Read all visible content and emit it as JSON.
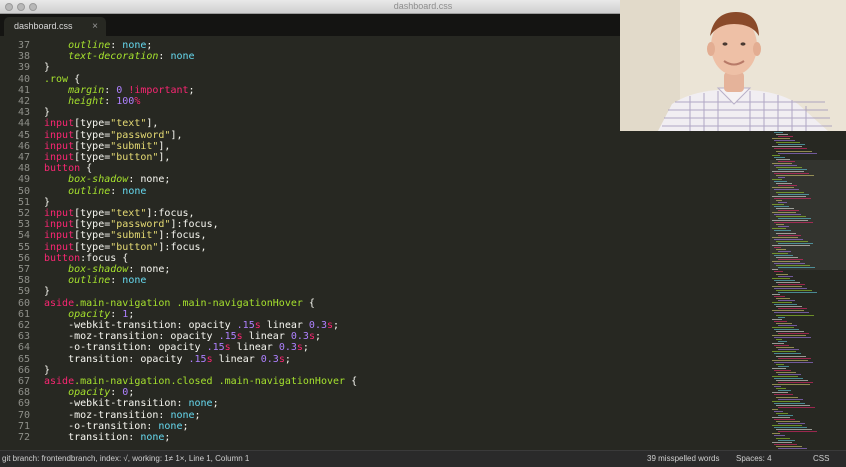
{
  "window": {
    "title": "dashboard.css"
  },
  "tab": {
    "label": "dashboard.css",
    "close": "×"
  },
  "editor": {
    "lines": [
      {
        "n": "37",
        "tokens": [
          [
            "    ",
            "txt"
          ],
          [
            "outline",
            "prop"
          ],
          [
            ": ",
            "txt"
          ],
          [
            "none",
            "val"
          ],
          [
            ";",
            "txt"
          ]
        ]
      },
      {
        "n": "38",
        "tokens": [
          [
            "    ",
            "txt"
          ],
          [
            "text-decoration",
            "prop"
          ],
          [
            ": ",
            "txt"
          ],
          [
            "none",
            "val"
          ]
        ]
      },
      {
        "n": "39",
        "tokens": [
          [
            "}",
            "txt"
          ]
        ]
      },
      {
        "n": "40",
        "tokens": [
          [
            ".row",
            "sel"
          ],
          [
            " {",
            "txt"
          ]
        ]
      },
      {
        "n": "41",
        "tokens": [
          [
            "    ",
            "txt"
          ],
          [
            "margin",
            "prop"
          ],
          [
            ": ",
            "txt"
          ],
          [
            "0",
            "num"
          ],
          [
            " ",
            "txt"
          ],
          [
            "!important",
            "imp"
          ],
          [
            ";",
            "txt"
          ]
        ]
      },
      {
        "n": "42",
        "tokens": [
          [
            "    ",
            "txt"
          ],
          [
            "height",
            "prop"
          ],
          [
            ": ",
            "txt"
          ],
          [
            "100",
            "num"
          ],
          [
            "%",
            "unit"
          ]
        ]
      },
      {
        "n": "43",
        "tokens": [
          [
            "}",
            "txt"
          ]
        ]
      },
      {
        "n": "44",
        "tokens": [
          [
            "input",
            "tag"
          ],
          [
            "[type=",
            "txt"
          ],
          [
            "\"text\"",
            "str"
          ],
          [
            "],",
            "txt"
          ]
        ]
      },
      {
        "n": "45",
        "tokens": [
          [
            "input",
            "tag"
          ],
          [
            "[type=",
            "txt"
          ],
          [
            "\"password\"",
            "str"
          ],
          [
            "],",
            "txt"
          ]
        ]
      },
      {
        "n": "46",
        "tokens": [
          [
            "input",
            "tag"
          ],
          [
            "[type=",
            "txt"
          ],
          [
            "\"submit\"",
            "str"
          ],
          [
            "],",
            "txt"
          ]
        ]
      },
      {
        "n": "47",
        "tokens": [
          [
            "input",
            "tag"
          ],
          [
            "[type=",
            "txt"
          ],
          [
            "\"button\"",
            "str"
          ],
          [
            "],",
            "txt"
          ]
        ]
      },
      {
        "n": "48",
        "tokens": [
          [
            "button",
            "tag"
          ],
          [
            " {",
            "txt"
          ]
        ]
      },
      {
        "n": "49",
        "tokens": [
          [
            "    ",
            "txt"
          ],
          [
            "box-shadow",
            "prop"
          ],
          [
            ": none;",
            "txt"
          ]
        ]
      },
      {
        "n": "50",
        "tokens": [
          [
            "    ",
            "txt"
          ],
          [
            "outline",
            "prop"
          ],
          [
            ": ",
            "txt"
          ],
          [
            "none",
            "val"
          ]
        ]
      },
      {
        "n": "51",
        "tokens": [
          [
            "}",
            "txt"
          ]
        ]
      },
      {
        "n": "52",
        "tokens": [
          [
            "input",
            "tag"
          ],
          [
            "[type=",
            "txt"
          ],
          [
            "\"text\"",
            "str"
          ],
          [
            "]:focus,",
            "txt"
          ]
        ]
      },
      {
        "n": "53",
        "tokens": [
          [
            "input",
            "tag"
          ],
          [
            "[type=",
            "txt"
          ],
          [
            "\"password\"",
            "str"
          ],
          [
            "]:focus,",
            "txt"
          ]
        ]
      },
      {
        "n": "54",
        "tokens": [
          [
            "input",
            "tag"
          ],
          [
            "[type=",
            "txt"
          ],
          [
            "\"submit\"",
            "str"
          ],
          [
            "]:focus,",
            "txt"
          ]
        ]
      },
      {
        "n": "55",
        "tokens": [
          [
            "input",
            "tag"
          ],
          [
            "[type=",
            "txt"
          ],
          [
            "\"button\"",
            "str"
          ],
          [
            "]:focus,",
            "txt"
          ]
        ]
      },
      {
        "n": "56",
        "tokens": [
          [
            "button",
            "tag"
          ],
          [
            ":focus {",
            "txt"
          ]
        ]
      },
      {
        "n": "57",
        "tokens": [
          [
            "    ",
            "txt"
          ],
          [
            "box-shadow",
            "prop"
          ],
          [
            ": none;",
            "txt"
          ]
        ]
      },
      {
        "n": "58",
        "tokens": [
          [
            "    ",
            "txt"
          ],
          [
            "outline",
            "prop"
          ],
          [
            ": ",
            "txt"
          ],
          [
            "none",
            "val"
          ]
        ]
      },
      {
        "n": "59",
        "tokens": [
          [
            "}",
            "txt"
          ]
        ]
      },
      {
        "n": "60",
        "tokens": [
          [
            "aside",
            "tag"
          ],
          [
            ".main-navigation .main-navigationHover",
            "sel"
          ],
          [
            " {",
            "txt"
          ]
        ]
      },
      {
        "n": "61",
        "tokens": [
          [
            "    ",
            "txt"
          ],
          [
            "opacity",
            "prop"
          ],
          [
            ": ",
            "txt"
          ],
          [
            "1",
            "num"
          ],
          [
            ";",
            "txt"
          ]
        ]
      },
      {
        "n": "62",
        "tokens": [
          [
            "    -webkit-transition: opacity ",
            "txt"
          ],
          [
            ".15",
            "num"
          ],
          [
            "s",
            "unit"
          ],
          [
            " linear ",
            "txt"
          ],
          [
            "0.3",
            "num"
          ],
          [
            "s",
            "unit"
          ],
          [
            ";",
            "txt"
          ]
        ]
      },
      {
        "n": "63",
        "tokens": [
          [
            "    -moz-transition: opacity ",
            "txt"
          ],
          [
            ".15",
            "num"
          ],
          [
            "s",
            "unit"
          ],
          [
            " linear ",
            "txt"
          ],
          [
            "0.3",
            "num"
          ],
          [
            "s",
            "unit"
          ],
          [
            ";",
            "txt"
          ]
        ]
      },
      {
        "n": "64",
        "tokens": [
          [
            "    -o-transition: opacity ",
            "txt"
          ],
          [
            ".15",
            "num"
          ],
          [
            "s",
            "unit"
          ],
          [
            " linear ",
            "txt"
          ],
          [
            "0.3",
            "num"
          ],
          [
            "s",
            "unit"
          ],
          [
            ";",
            "txt"
          ]
        ]
      },
      {
        "n": "65",
        "tokens": [
          [
            "    transition: opacity ",
            "txt"
          ],
          [
            ".15",
            "num"
          ],
          [
            "s",
            "unit"
          ],
          [
            " linear ",
            "txt"
          ],
          [
            "0.3",
            "num"
          ],
          [
            "s",
            "unit"
          ],
          [
            ";",
            "txt"
          ]
        ]
      },
      {
        "n": "66",
        "tokens": [
          [
            "}",
            "txt"
          ]
        ]
      },
      {
        "n": "67",
        "tokens": [
          [
            "aside",
            "tag"
          ],
          [
            ".main-navigation.closed .main-navigationHover",
            "sel"
          ],
          [
            " {",
            "txt"
          ]
        ]
      },
      {
        "n": "68",
        "tokens": [
          [
            "    ",
            "txt"
          ],
          [
            "opacity",
            "prop"
          ],
          [
            ": ",
            "txt"
          ],
          [
            "0",
            "num"
          ],
          [
            ";",
            "txt"
          ]
        ]
      },
      {
        "n": "69",
        "tokens": [
          [
            "    -webkit-transition: ",
            "txt"
          ],
          [
            "none",
            "val"
          ],
          [
            ";",
            "txt"
          ]
        ]
      },
      {
        "n": "70",
        "tokens": [
          [
            "    -moz-transition: ",
            "txt"
          ],
          [
            "none",
            "val"
          ],
          [
            ";",
            "txt"
          ]
        ]
      },
      {
        "n": "71",
        "tokens": [
          [
            "    -o-transition: ",
            "txt"
          ],
          [
            "none",
            "val"
          ],
          [
            ";",
            "txt"
          ]
        ]
      },
      {
        "n": "72",
        "tokens": [
          [
            "    transition: ",
            "txt"
          ],
          [
            "none",
            "val"
          ],
          [
            ";",
            "txt"
          ]
        ]
      }
    ]
  },
  "statusbar": {
    "git": "git branch: frontendbranch, index: √, working: 1≠ 1×, Line 1, Column 1",
    "spelling": "39 misspelled words",
    "spaces": "Spaces: 4",
    "syntax": "CSS"
  },
  "colors": {
    "background": "#272822",
    "property": "#a6e22e",
    "value": "#66d9ef",
    "tag": "#f92672",
    "string": "#e6db74",
    "number": "#ae81ff",
    "text": "#f8f8f2",
    "gutter": "#8f908a"
  }
}
